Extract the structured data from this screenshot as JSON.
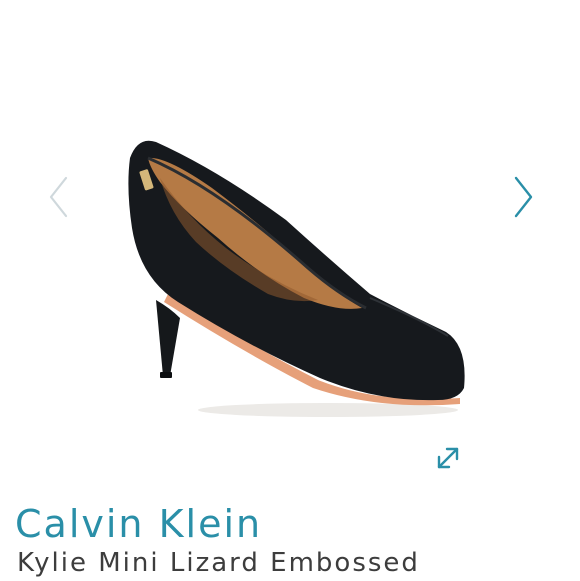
{
  "colors": {
    "brand_accent": "#2a8fa8",
    "nav_prev_color": "#cfd8dc",
    "nav_next_color": "#2a8fa8",
    "title_text": "#3d3d3d",
    "shoe_leather": "#16191d",
    "shoe_lining": "#b57a45"
  },
  "gallery": {
    "prev_icon": "chevron-left-icon",
    "next_icon": "chevron-right-icon",
    "expand_icon": "expand-icon",
    "image_subject": "black pointed-toe pump"
  },
  "product": {
    "brand": "Calvin Klein",
    "name": "Kylie Mini Lizard Embossed"
  }
}
